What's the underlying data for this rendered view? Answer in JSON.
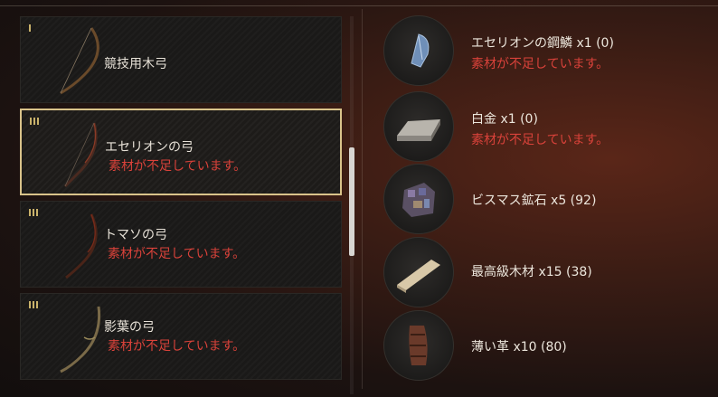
{
  "recipes": [
    {
      "name": "競技用木弓",
      "tier": 1,
      "status": ""
    },
    {
      "name": "エセリオンの弓",
      "tier": 3,
      "status": "素材が不足しています。"
    },
    {
      "name": "トマソの弓",
      "tier": 3,
      "status": "素材が不足しています。"
    },
    {
      "name": "影葉の弓",
      "tier": 3,
      "status": "素材が不足しています。"
    }
  ],
  "materials": [
    {
      "label": "エセリオンの鋼鱗 x1 (0)",
      "status": "素材が不足しています。",
      "icon": "blue-crystal-scale-icon"
    },
    {
      "label": "白金 x1 (0)",
      "status": "素材が不足しています。",
      "icon": "platinum-ingot-icon"
    },
    {
      "label": "ビスマス鉱石 x5 (92)",
      "status": "",
      "icon": "bismuth-ore-icon"
    },
    {
      "label": "最高級木材 x15 (38)",
      "status": "",
      "icon": "wood-plank-icon"
    },
    {
      "label": "薄い革 x10 (80)",
      "status": "",
      "icon": "rolled-leather-icon"
    }
  ],
  "colors": {
    "warning": "#d9423a",
    "selection": "#d9c38a"
  }
}
